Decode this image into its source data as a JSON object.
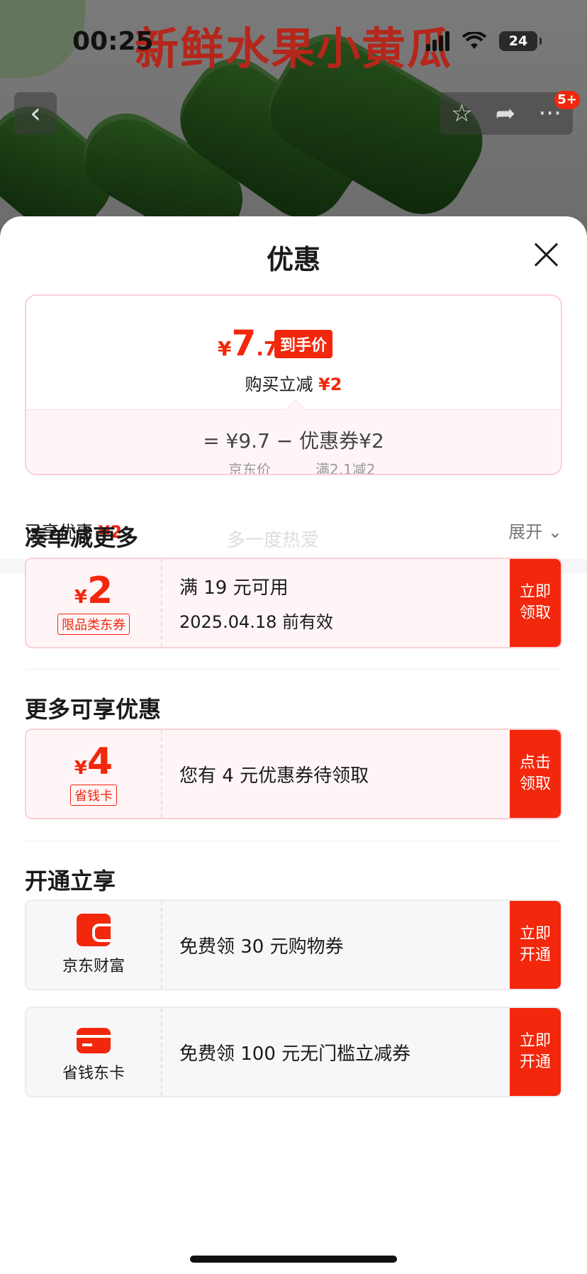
{
  "status": {
    "time": "00:25",
    "battery": "24"
  },
  "product": {
    "hero_title": "新鲜水果小黄瓜"
  },
  "nav": {
    "back_icon": "chevron-left-icon",
    "favorite_icon": "star-icon",
    "share_icon": "share-icon",
    "more_icon": "more-icon",
    "badge": "5+"
  },
  "sheet": {
    "title": "优惠",
    "price": {
      "currency": "¥",
      "int": "7",
      "dec": ".7",
      "tag": "到手价"
    },
    "instant": {
      "label": "购买立减",
      "value": "¥2"
    },
    "calc": {
      "line": "=  ¥9.7  −  优惠券¥2",
      "sub1": "京东价",
      "sub2": "满2.1减2"
    },
    "enjoyed": {
      "label": "已享优惠",
      "value": "¥2"
    },
    "expand": "展开 ⌄"
  },
  "sections": {
    "bundle": {
      "title": "凑单减更多",
      "watermark": "多一度热爱",
      "coupon": {
        "currency": "¥",
        "amount": "2",
        "chip": "限品类东券",
        "line1": "满 19 元可用",
        "line2": "2025.04.18 前有效",
        "button": "立即领取"
      }
    },
    "more": {
      "title": "更多可享优惠",
      "coupon": {
        "currency": "¥",
        "amount": "4",
        "chip": "省钱卡",
        "line1": "您有 4 元优惠券待领取",
        "button": "点击领取"
      }
    },
    "open": {
      "title": "开通立享",
      "items": [
        {
          "icon": "wallet-icon",
          "label": "京东财富",
          "line1": "免费领 30 元购物券",
          "button": "立即开通"
        },
        {
          "icon": "card-icon",
          "label": "省钱东卡",
          "line1": "免费领 100 元无门槛立减券",
          "button": "立即开通"
        }
      ]
    }
  },
  "colors": {
    "accent": "#f2270c",
    "card_border": "#fbd0d5",
    "card_bg": "#fff5f7"
  }
}
